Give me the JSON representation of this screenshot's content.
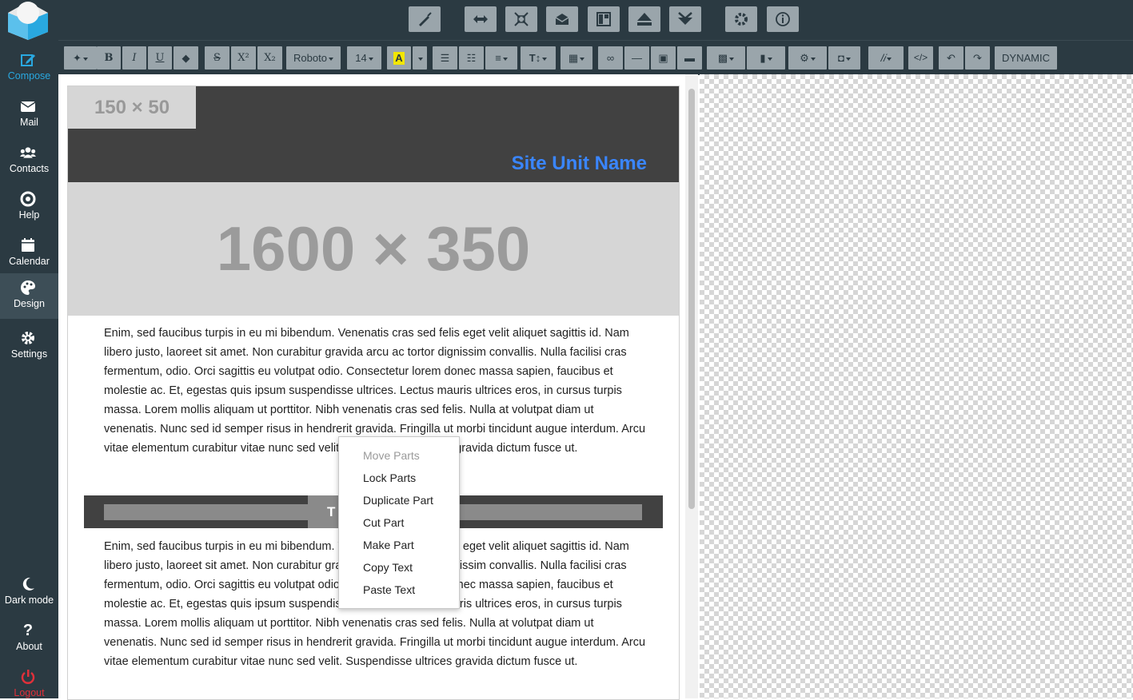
{
  "sidebar": {
    "items": [
      {
        "label": "Compose",
        "icon": "compose-icon"
      },
      {
        "label": "Mail",
        "icon": "mail-icon"
      },
      {
        "label": "Contacts",
        "icon": "contacts-icon"
      },
      {
        "label": "Help",
        "icon": "help-icon"
      },
      {
        "label": "Calendar",
        "icon": "calendar-icon"
      },
      {
        "label": "Design",
        "icon": "palette-icon"
      },
      {
        "label": "Settings",
        "icon": "gear-icon"
      }
    ],
    "bottom": [
      {
        "label": "Dark mode",
        "icon": "moon-icon"
      },
      {
        "label": "About",
        "icon": "question-icon"
      },
      {
        "label": "Logout",
        "icon": "power-icon"
      }
    ],
    "active": "Design"
  },
  "toolbar": {
    "font_family": "Roboto",
    "font_size": "14",
    "dynamic_label": "DYNAMIC",
    "code_label": "</>",
    "text_size_label": "T↕"
  },
  "document": {
    "logo_placeholder": "150 × 50",
    "site_name": "Site Unit Name",
    "hero_placeholder": "1600 × 350",
    "title_chip": "T",
    "paragraph_1": "Enim, sed faucibus turpis in eu mi bibendum. Venenatis cras sed felis eget velit aliquet sagittis id. Nam libero justo, laoreet sit amet. Non curabitur gravida arcu ac tortor dignissim convallis. Nulla facilisi cras fermentum, odio. Orci sagittis eu volutpat odio. Consectetur lorem donec massa sapien, faucibus et molestie ac. Et, egestas quis ipsum suspendisse ultrices. Lectus mauris ultrices eros, in cursus turpis massa. Lorem mollis aliquam ut porttitor. Nibh venenatis cras sed felis. Nulla at volutpat diam ut venenatis. Nunc sed id semper risus in hendrerit gravida. Fringilla ut morbi tincidunt augue interdum. Arcu vitae elementum curabitur vitae nunc sed velit. Suspendisse ultrices gravida dictum fusce ut.",
    "paragraph_2": "Enim, sed faucibus turpis in eu mi bibendum. Venenatis cras sed felis eget velit aliquet sagittis id. Nam libero justo, laoreet sit amet. Non curabitur gravida arcu ac tortor dignissim convallis. Nulla facilisi cras fermentum, odio. Orci sagittis eu volutpat odio. Consectetur lorem donec massa sapien, faucibus et molestie ac. Et, egestas quis ipsum suspendisse ultrices. Lectus mauris ultrices eros, in cursus turpis massa. Lorem mollis aliquam ut porttitor. Nibh venenatis cras sed felis. Nulla at volutpat diam ut venenatis. Nunc sed id semper risus in hendrerit gravida. Fringilla ut morbi tincidunt augue interdum. Arcu vitae elementum curabitur vitae nunc sed velit. Suspendisse ultrices gravida dictum fusce ut."
  },
  "context_menu": {
    "items": [
      {
        "label": "Move Parts",
        "disabled": true
      },
      {
        "label": "Lock Parts",
        "disabled": false
      },
      {
        "label": "Duplicate Part",
        "disabled": false
      },
      {
        "label": "Cut Part",
        "disabled": false
      },
      {
        "label": "Make Part",
        "disabled": false
      },
      {
        "label": "Copy Text",
        "disabled": false
      },
      {
        "label": "Paste Text",
        "disabled": false
      }
    ]
  },
  "colors": {
    "sidebar_bg": "#2b3a42",
    "accent_blue": "#29a8e0",
    "site_name": "#3a86ff",
    "logout_red": "#e0303a",
    "button_bg": "#9aa5ab"
  }
}
